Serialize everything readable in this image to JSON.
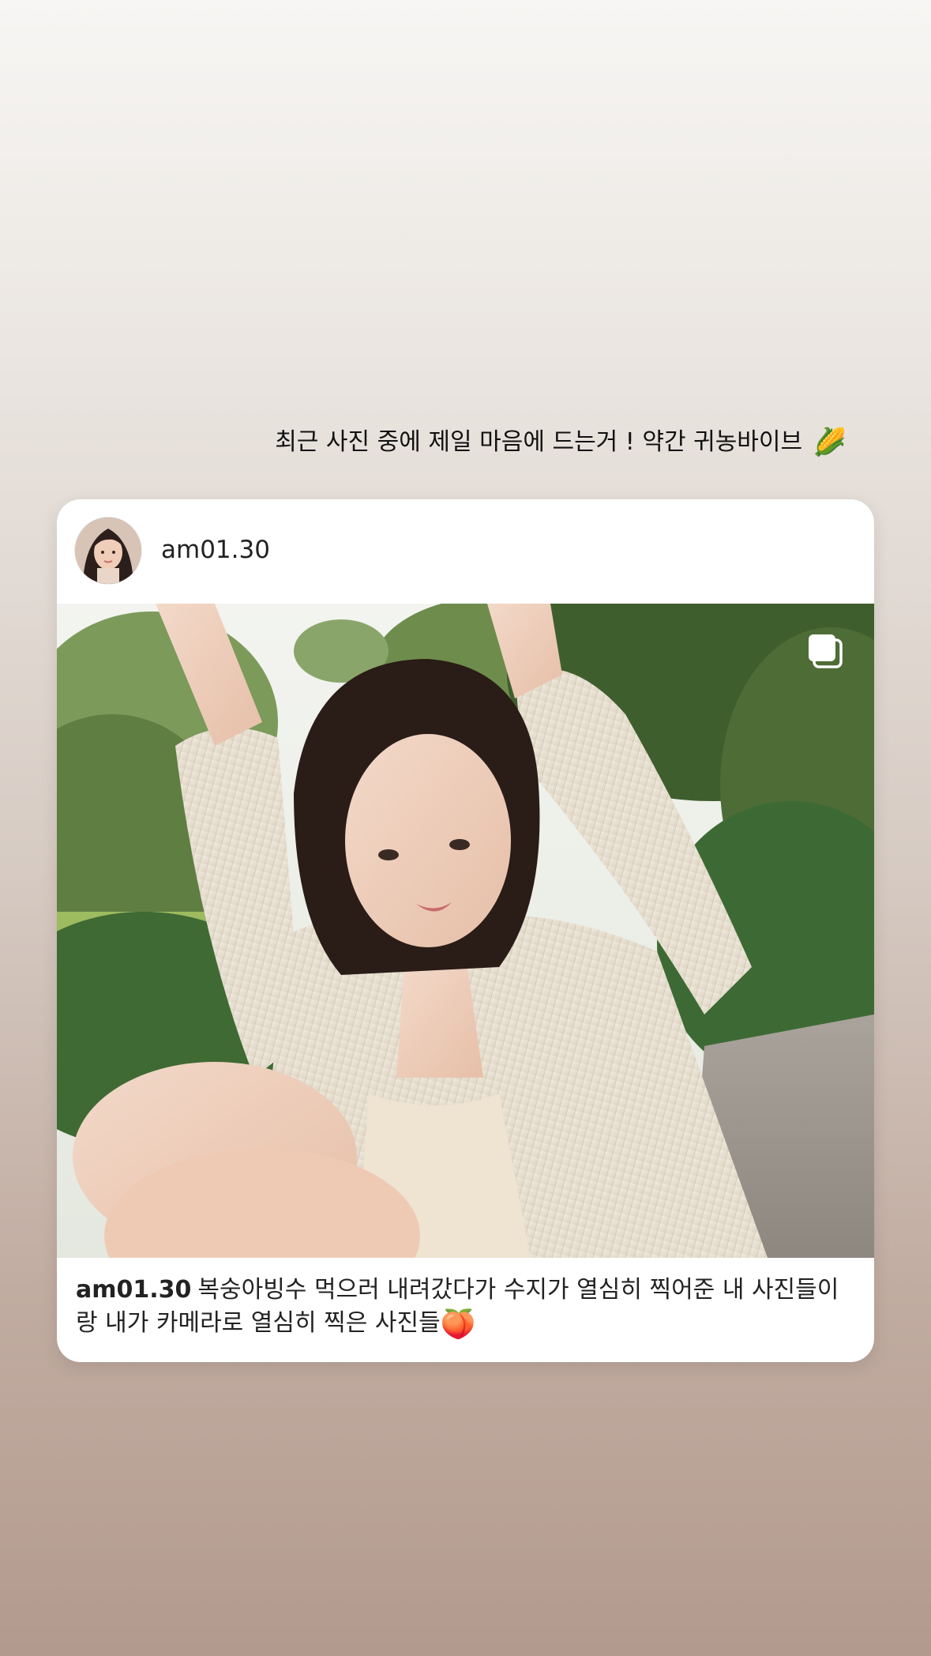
{
  "story": {
    "text": "최근 사진 중에 제일 마음에 드는거 ! 약간 귀농바이브",
    "emoji": "🌽"
  },
  "post": {
    "username": "am01.30",
    "avatar_icon": "avatar-photo",
    "multi_photo_icon": "carousel-icon",
    "caption_user": "am01.30",
    "caption_text": "복숭아빙수 먹으러 내려갔다가 수지가 열심히 찍어준 내 사진들이랑 내가 카메라로 열심히 찍은 사진들",
    "caption_emoji": "🍑"
  },
  "colors": {
    "background_top": "#f7f6f4",
    "background_bottom": "#b39a8e",
    "card": "#ffffff",
    "text": "#222222"
  }
}
